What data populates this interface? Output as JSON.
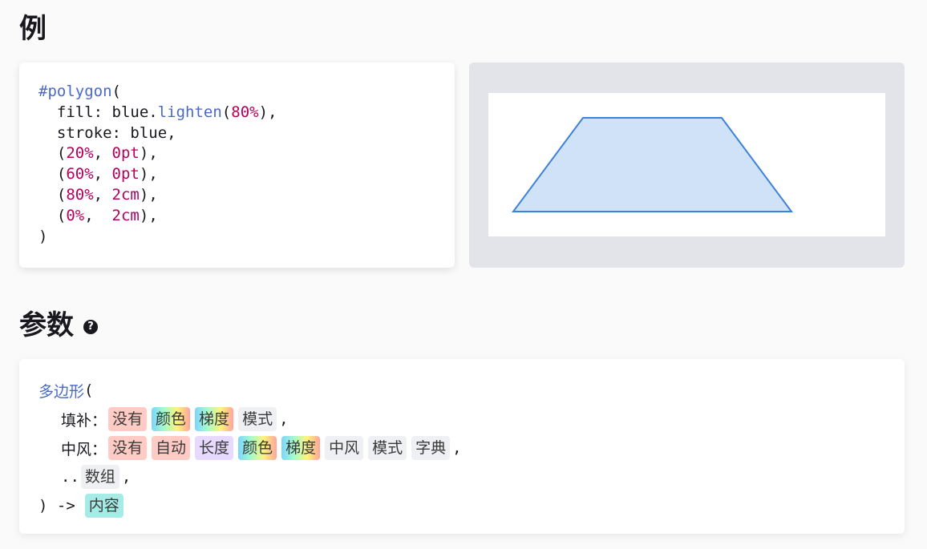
{
  "headings": {
    "example": "例",
    "parameters": "参数",
    "help_icon": "?"
  },
  "code_lines": [
    [
      {
        "t": "#polygon",
        "c": "fn"
      },
      {
        "t": "(",
        "c": ""
      }
    ],
    [
      {
        "t": "  fill: blue.",
        "c": ""
      },
      {
        "t": "lighten",
        "c": "fn"
      },
      {
        "t": "(",
        "c": ""
      },
      {
        "t": "80%",
        "c": "num"
      },
      {
        "t": "),",
        "c": ""
      }
    ],
    [
      {
        "t": "  stroke: blue,",
        "c": ""
      }
    ],
    [
      {
        "t": "  (",
        "c": ""
      },
      {
        "t": "20%",
        "c": "num"
      },
      {
        "t": ", ",
        "c": ""
      },
      {
        "t": "0pt",
        "c": "num"
      },
      {
        "t": "),",
        "c": ""
      }
    ],
    [
      {
        "t": "  (",
        "c": ""
      },
      {
        "t": "60%",
        "c": "num"
      },
      {
        "t": ", ",
        "c": ""
      },
      {
        "t": "0pt",
        "c": "num"
      },
      {
        "t": "),",
        "c": ""
      }
    ],
    [
      {
        "t": "  (",
        "c": ""
      },
      {
        "t": "80%",
        "c": "num"
      },
      {
        "t": ", ",
        "c": ""
      },
      {
        "t": "2cm",
        "c": "num"
      },
      {
        "t": "),",
        "c": ""
      }
    ],
    [
      {
        "t": "  (",
        "c": ""
      },
      {
        "t": "0%",
        "c": "num"
      },
      {
        "t": ",  ",
        "c": ""
      },
      {
        "t": "2cm",
        "c": "num"
      },
      {
        "t": "),",
        "c": ""
      }
    ],
    [
      {
        "t": ")",
        "c": ""
      }
    ]
  ],
  "preview": {
    "fill_color": "#cfe2f7",
    "stroke_color": "#3e82d7"
  },
  "signature": {
    "function_name": "多边形",
    "open": "(",
    "params": [
      {
        "name": "填补：",
        "types": [
          {
            "label": "没有",
            "style": "none"
          },
          {
            "label": "颜色",
            "style": "rainbow"
          },
          {
            "label": "梯度",
            "style": "rainbow"
          },
          {
            "label": "模式",
            "style": "plain"
          }
        ],
        "suffix": ","
      },
      {
        "name": "中风：",
        "types": [
          {
            "label": "没有",
            "style": "none"
          },
          {
            "label": "自动",
            "style": "auto"
          },
          {
            "label": "长度",
            "style": "length"
          },
          {
            "label": "颜色",
            "style": "rainbow"
          },
          {
            "label": "梯度",
            "style": "rainbow"
          },
          {
            "label": "中风",
            "style": "plain"
          },
          {
            "label": "模式",
            "style": "plain"
          },
          {
            "label": "字典",
            "style": "plain"
          }
        ],
        "suffix": ","
      },
      {
        "name": "..",
        "types": [
          {
            "label": "数组",
            "style": "plain"
          }
        ],
        "suffix": ","
      }
    ],
    "close": ") ->",
    "return_type": "内容"
  }
}
